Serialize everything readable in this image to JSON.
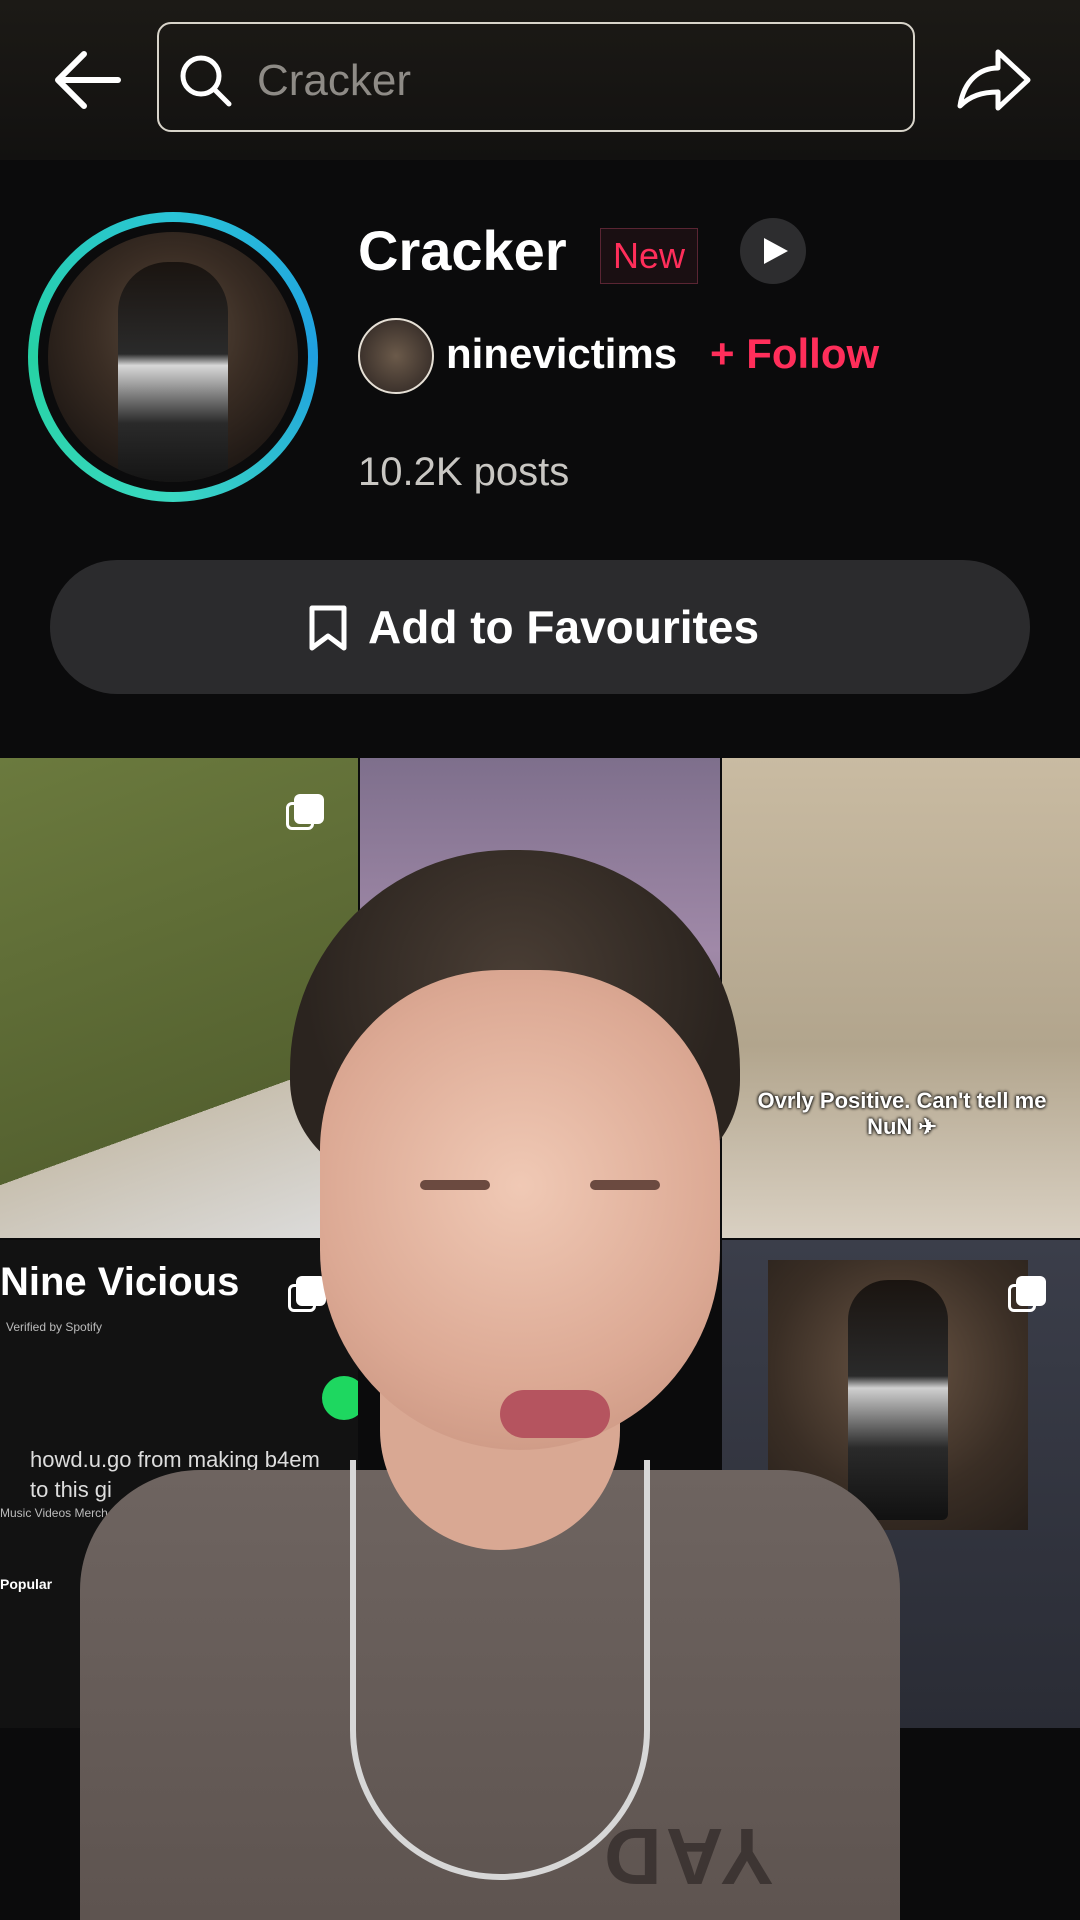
{
  "search": {
    "query": "Cracker"
  },
  "sound": {
    "title": "Cracker",
    "badge": "New",
    "creator": "ninevictims",
    "follow_label": "+ Follow",
    "posts": "10.2K posts"
  },
  "favourites": {
    "label": "Add to Favourites"
  },
  "grid": {
    "tile3_caption": "Ovrly Positive. Can't tell me NuN ✈",
    "tile4_artist": "Nine Vicious",
    "tile4_verified": "Verified by Spotify",
    "tile4_song": "howd.u.go from making b4em to this gi",
    "tile4_tabs": "Music   Videos   Merch",
    "tile4_popular": "Popular"
  },
  "overlay": {
    "shirt_print": "YAD"
  },
  "colors": {
    "accent": "#ff2e5a",
    "ring": "#2ac4d8",
    "button_bg": "#2b2b2d"
  }
}
